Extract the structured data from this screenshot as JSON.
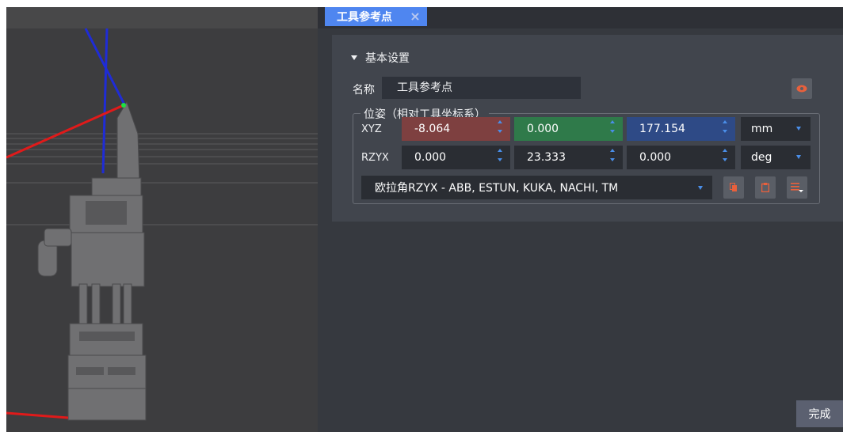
{
  "tab": {
    "title": "工具参考点",
    "close_icon": "×"
  },
  "section": {
    "title": "基本设置"
  },
  "name": {
    "label": "名称",
    "value": "工具参考点"
  },
  "pose": {
    "legend": "位姿（相对工具坐标系）",
    "xyz": {
      "label": "XYZ",
      "x": "-8.064",
      "y": "0.000",
      "z": "177.154",
      "unit": "mm"
    },
    "rzyx": {
      "label": "RZYX",
      "rz": "0.000",
      "ry": "23.333",
      "rx": "0.000",
      "unit": "deg"
    },
    "convention": "欧拉角RZYX - ABB, ESTUN, KUKA, NACHI, TM"
  },
  "footer": {
    "done_label": "完成"
  },
  "colors": {
    "tab_active": "#4f86f0",
    "x_field": "#7e4040",
    "y_field": "#2f7a4a",
    "z_field": "#2e4a86",
    "accent_icon": "#e8603c"
  }
}
